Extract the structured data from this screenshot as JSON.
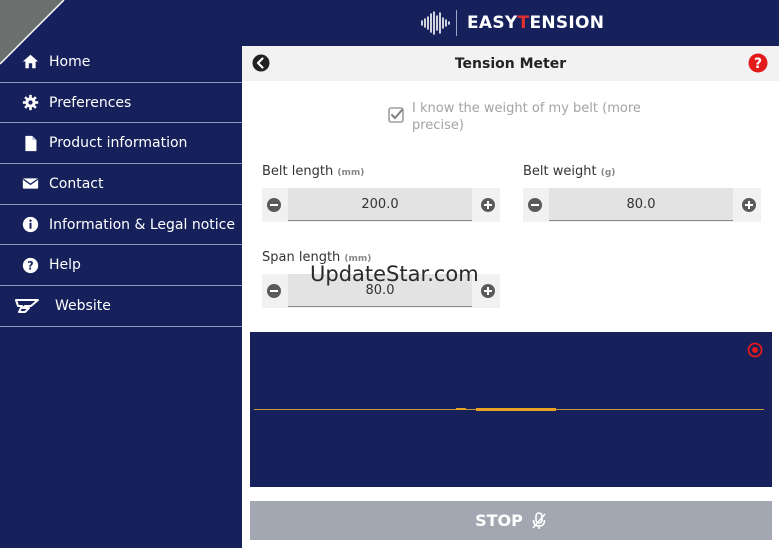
{
  "brand": {
    "name_prefix": "EASY",
    "name_t": "T",
    "name_suffix": "ENSION"
  },
  "sidebar": {
    "items": [
      {
        "label": "Home",
        "icon": "home-icon"
      },
      {
        "label": "Preferences",
        "icon": "gear-icon"
      },
      {
        "label": "Product information",
        "icon": "document-icon"
      },
      {
        "label": "Contact",
        "icon": "envelope-icon"
      },
      {
        "label": "Information & Legal notice",
        "icon": "info-icon"
      },
      {
        "label": "Help",
        "icon": "question-icon"
      },
      {
        "label": "Website",
        "icon": "gates-logo-icon"
      }
    ]
  },
  "main": {
    "title": "Tension Meter",
    "checkbox": {
      "label": "I know the weight of my belt (more precise)",
      "checked": true
    },
    "fields": {
      "belt_length": {
        "label": "Belt length",
        "unit": "(mm)",
        "value": "200.0"
      },
      "belt_weight": {
        "label": "Belt weight",
        "unit": "(g)",
        "value": "80.0"
      },
      "span_length": {
        "label": "Span length",
        "unit": "(mm)",
        "value": "80.0"
      }
    },
    "stop_label": "STOP"
  },
  "watermark": "UpdateStar.com",
  "colors": {
    "navy": "#16215c",
    "accent_red": "#e23030",
    "signal": "#e6a221",
    "stop_bg": "#a2a7b2"
  }
}
